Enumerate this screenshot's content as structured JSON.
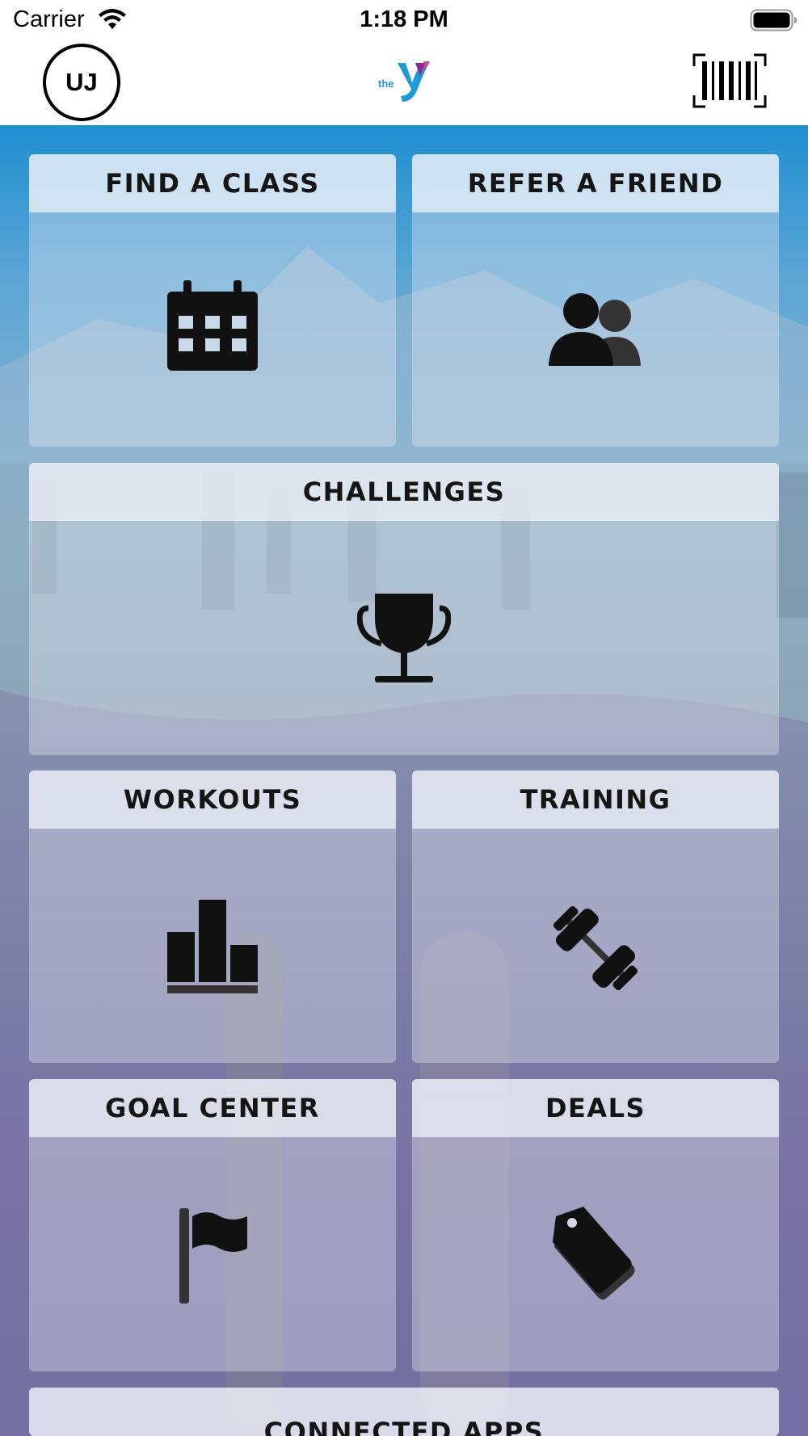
{
  "status_bar": {
    "carrier": "Carrier",
    "time": "1:18 PM"
  },
  "nav": {
    "avatar_initials": "UJ",
    "logo_text": "the",
    "logo_icon": "ymca-logo",
    "barcode_icon": "barcode-icon"
  },
  "tiles": [
    {
      "label": "FIND A CLASS",
      "icon": "calendar-icon"
    },
    {
      "label": "REFER A FRIEND",
      "icon": "people-icon"
    },
    {
      "label": "CHALLENGES",
      "icon": "trophy-icon"
    },
    {
      "label": "WORKOUTS",
      "icon": "bar-chart-icon"
    },
    {
      "label": "TRAINING",
      "icon": "dumbbell-icon"
    },
    {
      "label": "GOAL CENTER",
      "icon": "flag-icon"
    },
    {
      "label": "DEALS",
      "icon": "tag-icon"
    },
    {
      "label": "CONNECTED APPS",
      "icon": ""
    }
  ],
  "colors": {
    "ymca_blue": "#1e9ad6",
    "ymca_purple": "#92278f",
    "header_band": "#1f8fd0",
    "icon": "#111111"
  }
}
